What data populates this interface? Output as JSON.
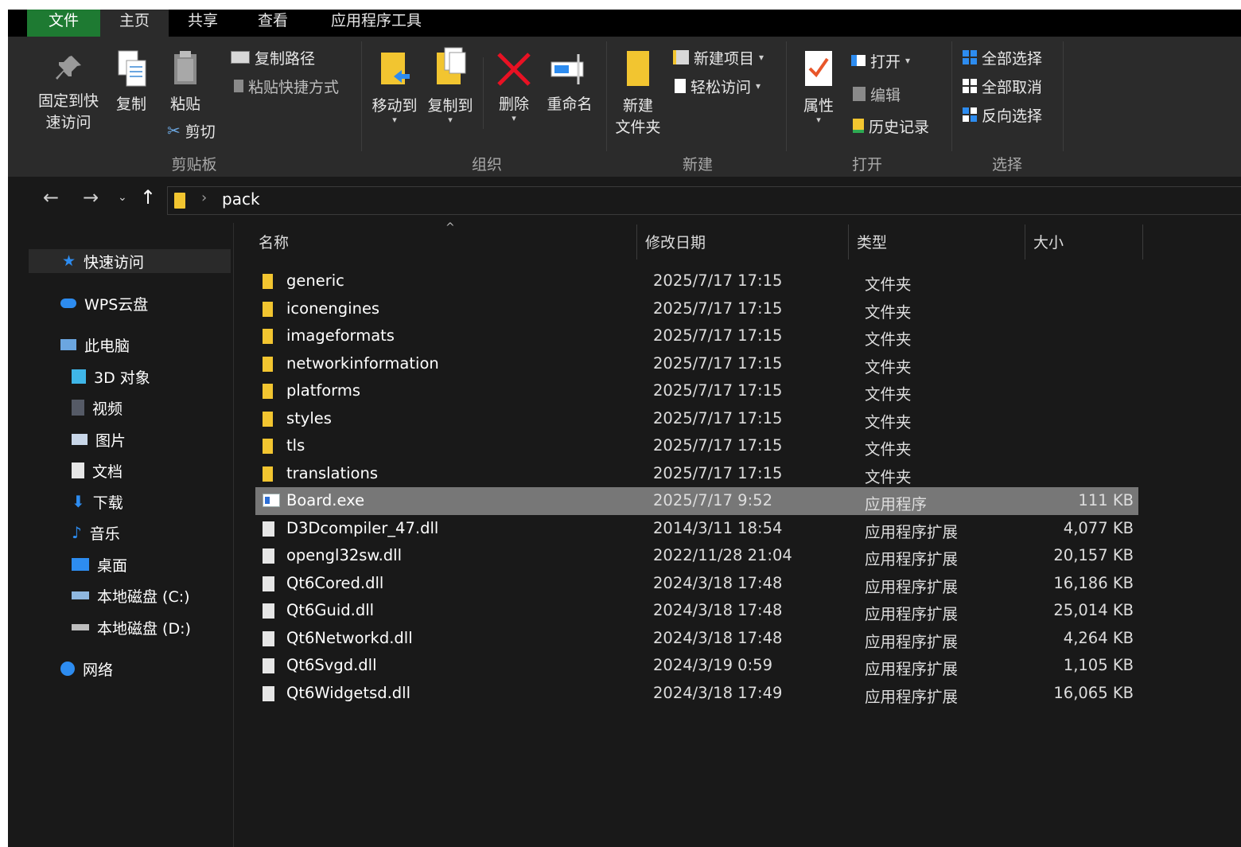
{
  "tabs": [
    "文件",
    "主页",
    "共享",
    "查看",
    "应用程序工具"
  ],
  "ribbon": {
    "clipboard": {
      "pin_label_1": "固定到快",
      "pin_label_2": "速访问",
      "copy_label": "复制",
      "paste_label": "粘贴",
      "copy_path": "复制路径",
      "paste_shortcut": "粘贴快捷方式",
      "cut": "剪切",
      "group": "剪贴板"
    },
    "organize": {
      "move_to": "移动到",
      "copy_to": "复制到",
      "delete": "删除",
      "rename": "重命名",
      "group": "组织"
    },
    "new": {
      "new_folder_1": "新建",
      "new_folder_2": "文件夹",
      "new_item": "新建项目",
      "easy_access": "轻松访问",
      "group": "新建"
    },
    "open": {
      "properties": "属性",
      "open": "打开",
      "edit": "编辑",
      "history": "历史记录",
      "group": "打开"
    },
    "select": {
      "select_all": "全部选择",
      "select_none": "全部取消",
      "invert": "反向选择",
      "group": "选择"
    }
  },
  "address": {
    "path": "pack"
  },
  "nav": {
    "quick_access": "快速访问",
    "wps": "WPS云盘",
    "this_pc": "此电脑",
    "objects3d": "3D 对象",
    "videos": "视频",
    "pictures": "图片",
    "documents": "文档",
    "downloads": "下载",
    "music": "音乐",
    "desktop": "桌面",
    "disk_c": "本地磁盘 (C:)",
    "disk_d": "本地磁盘 (D:)",
    "network": "网络"
  },
  "columns": {
    "name": "名称",
    "date": "修改日期",
    "type": "类型",
    "size": "大小"
  },
  "files": [
    {
      "name": "generic",
      "date": "2025/7/17 17:15",
      "type": "文件夹",
      "size": "",
      "kind": "folder"
    },
    {
      "name": "iconengines",
      "date": "2025/7/17 17:15",
      "type": "文件夹",
      "size": "",
      "kind": "folder"
    },
    {
      "name": "imageformats",
      "date": "2025/7/17 17:15",
      "type": "文件夹",
      "size": "",
      "kind": "folder"
    },
    {
      "name": "networkinformation",
      "date": "2025/7/17 17:15",
      "type": "文件夹",
      "size": "",
      "kind": "folder"
    },
    {
      "name": "platforms",
      "date": "2025/7/17 17:15",
      "type": "文件夹",
      "size": "",
      "kind": "folder"
    },
    {
      "name": "styles",
      "date": "2025/7/17 17:15",
      "type": "文件夹",
      "size": "",
      "kind": "folder"
    },
    {
      "name": "tls",
      "date": "2025/7/17 17:15",
      "type": "文件夹",
      "size": "",
      "kind": "folder"
    },
    {
      "name": "translations",
      "date": "2025/7/17 17:15",
      "type": "文件夹",
      "size": "",
      "kind": "folder"
    },
    {
      "name": "Board.exe",
      "date": "2025/7/17 9:52",
      "type": "应用程序",
      "size": "111 KB",
      "kind": "exe"
    },
    {
      "name": "D3Dcompiler_47.dll",
      "date": "2014/3/11 18:54",
      "type": "应用程序扩展",
      "size": "4,077 KB",
      "kind": "dll"
    },
    {
      "name": "opengl32sw.dll",
      "date": "2022/11/28 21:04",
      "type": "应用程序扩展",
      "size": "20,157 KB",
      "kind": "dll"
    },
    {
      "name": "Qt6Cored.dll",
      "date": "2024/3/18 17:48",
      "type": "应用程序扩展",
      "size": "16,186 KB",
      "kind": "dll"
    },
    {
      "name": "Qt6Guid.dll",
      "date": "2024/3/18 17:48",
      "type": "应用程序扩展",
      "size": "25,014 KB",
      "kind": "dll"
    },
    {
      "name": "Qt6Networkd.dll",
      "date": "2024/3/18 17:48",
      "type": "应用程序扩展",
      "size": "4,264 KB",
      "kind": "dll"
    },
    {
      "name": "Qt6Svgd.dll",
      "date": "2024/3/19 0:59",
      "type": "应用程序扩展",
      "size": "1,105 KB",
      "kind": "dll"
    },
    {
      "name": "Qt6Widgetsd.dll",
      "date": "2024/3/18 17:49",
      "type": "应用程序扩展",
      "size": "16,065 KB",
      "kind": "dll"
    }
  ],
  "selected_file": "Board.exe",
  "colors": {
    "file_tab": "#1e7a32",
    "selection": "#777777",
    "folder": "#f2c530",
    "accent_blue": "#2d8cf0",
    "delete_red": "#e81123"
  }
}
